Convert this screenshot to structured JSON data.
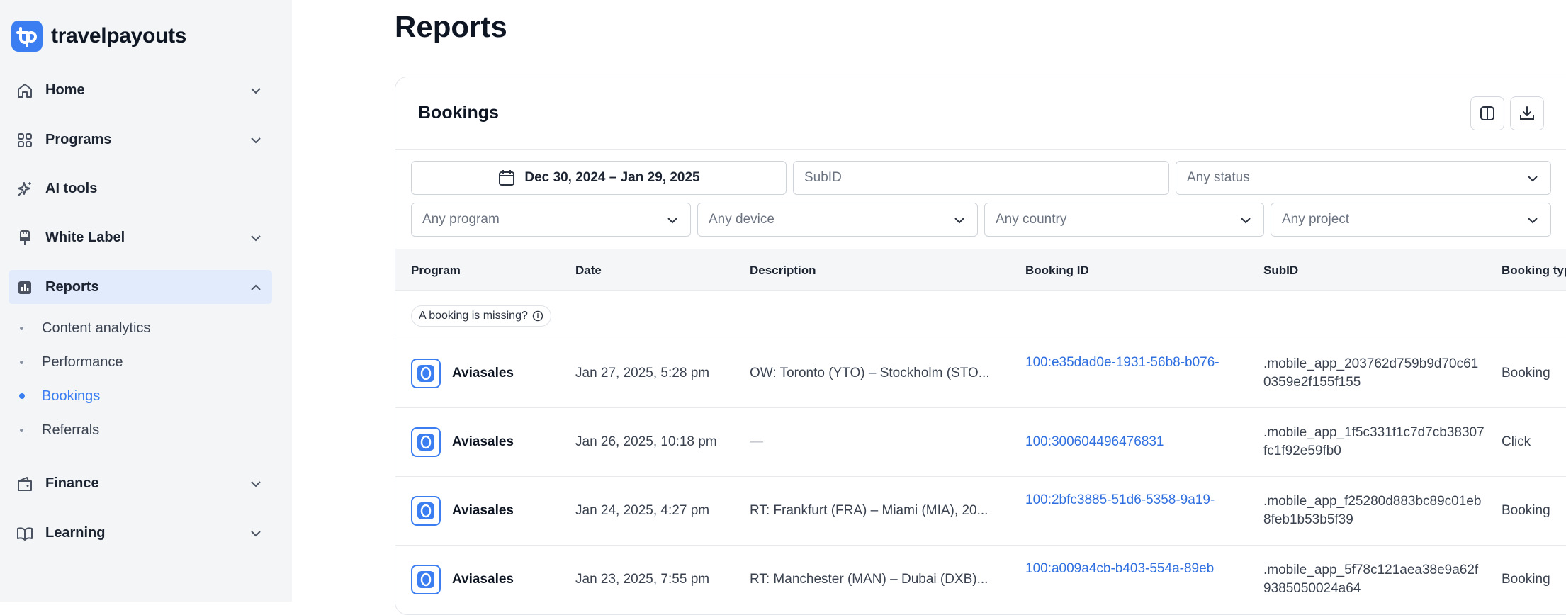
{
  "brand": {
    "name": "travelpayouts"
  },
  "sidebar": {
    "items": [
      {
        "label": "Home",
        "icon": "home-icon"
      },
      {
        "label": "Programs",
        "icon": "grid-icon"
      },
      {
        "label": "AI tools",
        "icon": "sparkles-icon"
      },
      {
        "label": "White Label",
        "icon": "brush-icon"
      },
      {
        "label": "Reports",
        "icon": "bar-chart-icon"
      },
      {
        "label": "Finance",
        "icon": "wallet-icon"
      },
      {
        "label": "Learning",
        "icon": "book-icon"
      }
    ],
    "reports_sub": [
      {
        "label": "Content analytics"
      },
      {
        "label": "Performance"
      },
      {
        "label": "Bookings"
      },
      {
        "label": "Referrals"
      }
    ],
    "active_item": "Reports",
    "active_sub": "Bookings"
  },
  "page": {
    "title": "Reports"
  },
  "card": {
    "title": "Bookings"
  },
  "filters": {
    "date_range": "Dec 30, 2024 – Jan 29, 2025",
    "subid_placeholder": "SubID",
    "status": "Any status",
    "program": "Any program",
    "device": "Any device",
    "country": "Any country",
    "project": "Any project"
  },
  "table": {
    "columns": [
      "Program",
      "Date",
      "Description",
      "Booking ID",
      "SubID",
      "Booking typ"
    ],
    "missing_label": "A booking is missing?",
    "rows": [
      {
        "program": "Aviasales",
        "date": "Jan 27, 2025, 5:28 pm",
        "description": "OW: Toronto (YTO) – Stockholm (STO...",
        "booking_id": "100:e35dad0e-1931-56b8-b076-",
        "subid": ".mobile_app_203762d759b9d70c610359e2f155f155",
        "type": "Booking"
      },
      {
        "program": "Aviasales",
        "date": "Jan 26, 2025, 10:18 pm",
        "description": "—",
        "booking_id": "100:300604496476831",
        "subid": ".mobile_app_1f5c331f1c7d7cb38307fc1f92e59fb0",
        "type": "Click"
      },
      {
        "program": "Aviasales",
        "date": "Jan 24, 2025, 4:27 pm",
        "description": "RT: Frankfurt (FRA) – Miami (MIA), 20...",
        "booking_id": "100:2bfc3885-51d6-5358-9a19-",
        "subid": ".mobile_app_f25280d883bc89c01eb8feb1b53b5f39",
        "type": "Booking"
      },
      {
        "program": "Aviasales",
        "date": "Jan 23, 2025, 7:55 pm",
        "description": "RT: Manchester (MAN) – Dubai (DXB)...",
        "booking_id": "100:a009a4cb-b403-554a-89eb",
        "subid": ".mobile_app_5f78c121aea38e9a62f9385050024a64",
        "type": "Booking"
      }
    ]
  },
  "colors": {
    "accent": "#3b7ef1",
    "sidebar_bg": "#f3f5f7",
    "active_bg": "#e2ebfb",
    "link": "#2f6fe0"
  }
}
